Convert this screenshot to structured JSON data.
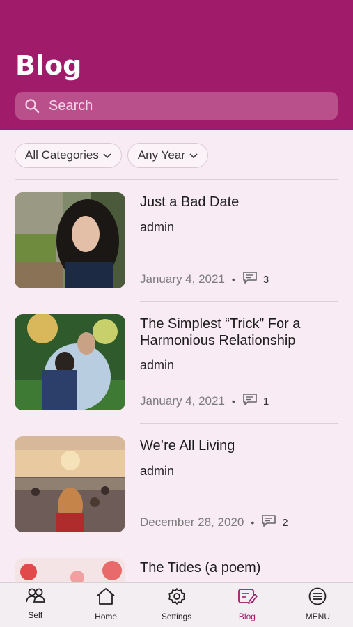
{
  "header": {
    "title": "Blog",
    "search_placeholder": "Search"
  },
  "filters": {
    "category": "All Categories",
    "year": "Any Year"
  },
  "posts": [
    {
      "title": "Just a Bad Date",
      "author": "admin",
      "date": "January 4, 2021",
      "comments": "3"
    },
    {
      "title": "The Simplest “Trick” For a Harmonious Relationship",
      "author": "admin",
      "date": "January 4, 2021",
      "comments": "1"
    },
    {
      "title": "We’re All Living",
      "author": "admin",
      "date": "December 28, 2020",
      "comments": "2"
    },
    {
      "title": "The Tides (a poem)"
    }
  ],
  "tabbar": {
    "items": [
      {
        "label": "Self",
        "icon": "people-icon"
      },
      {
        "label": "Home",
        "icon": "home-icon"
      },
      {
        "label": "Settings",
        "icon": "gear-icon"
      },
      {
        "label": "Blog",
        "icon": "blog-icon",
        "active": true
      },
      {
        "label": "MENU",
        "icon": "menu-icon"
      }
    ]
  },
  "colors": {
    "brand": "#a01c6a",
    "background": "#f8ebf4",
    "search_bg": "#b94f8b"
  }
}
